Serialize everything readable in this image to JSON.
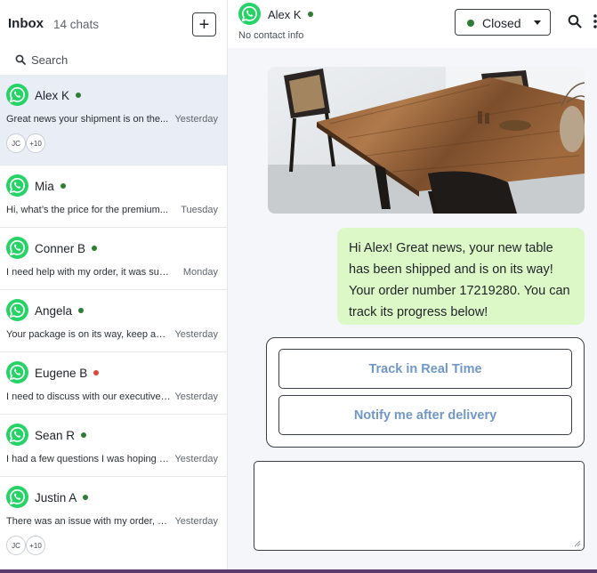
{
  "inbox": {
    "title": "Inbox",
    "count": "14 chats",
    "add_label": "+",
    "search_placeholder": "Search"
  },
  "chats": [
    {
      "name": "Alex K",
      "preview": "Great news your shipment is on the...",
      "time": "Yesterday",
      "online": "green",
      "avatars": [
        "JC",
        "+10"
      ]
    },
    {
      "name": "Mia",
      "preview": "Hi, what’s the price for the premium...",
      "time": "Tuesday",
      "online": "green"
    },
    {
      "name": "Conner B",
      "preview": "I need help with my order, it was sup...",
      "time": "Monday",
      "online": "green"
    },
    {
      "name": "Angela",
      "preview": "Your package is on its way, keep an e...",
      "time": "Yesterday",
      "online": "green"
    },
    {
      "name": "Eugene B",
      "preview": "I need to discuss with our executive t...",
      "time": "Yesterday",
      "online": "red"
    },
    {
      "name": "Sean R",
      "preview": "I had a few questions I was hoping y...",
      "time": "Yesterday",
      "online": "green"
    },
    {
      "name": "Justin A",
      "preview": "There was an issue with my order, wh...",
      "time": "Yesterday",
      "online": "green",
      "avatars": [
        "JC",
        "+10"
      ]
    }
  ],
  "conversation": {
    "contact_name": "Alex K",
    "contact_sub": "No contact info",
    "status": "Closed",
    "message": "Hi Alex! Great news, your new table has been shipped and is on its way! Your order number 17219280. You can track its progress below!",
    "buttons": [
      "Track in Real Time",
      "Notify me after delivery"
    ]
  },
  "colors": {
    "online": "#2e7d32",
    "busy": "#e0453a",
    "whatsapp": "#25d366",
    "bubble": "#dcf8c6",
    "link_button": "#6f97c9",
    "active_row": "#e9edf5"
  },
  "icons": {
    "channel": "whatsapp-icon",
    "search": "search-icon",
    "add": "plus-icon",
    "more": "more-vertical-icon"
  }
}
